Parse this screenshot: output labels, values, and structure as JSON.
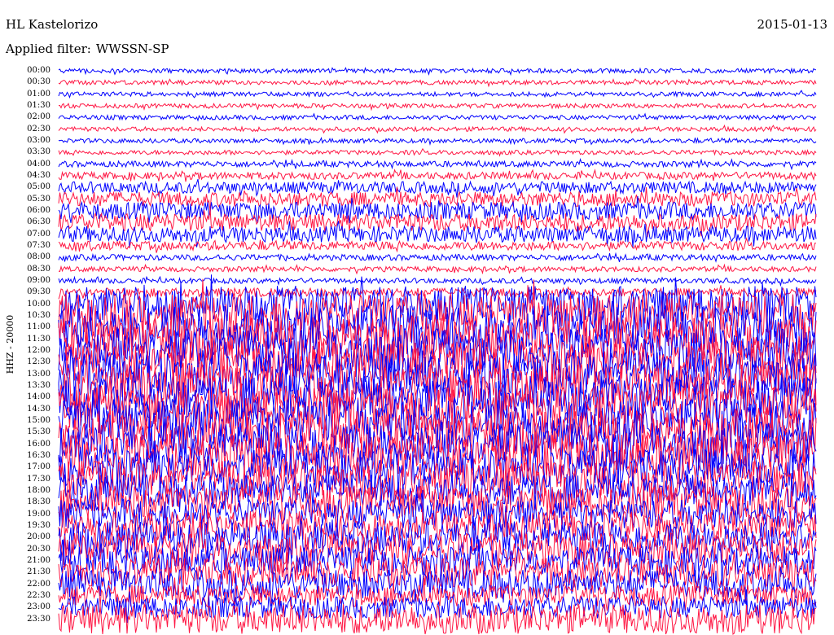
{
  "header": {
    "station": "HL Kastelorizo",
    "filter_label": "Applied filter:",
    "filter_value": "WWSSN-SP",
    "date": "2015-01-13"
  },
  "channel_label": "HHZ - 20000",
  "colors": {
    "trace_a": "#0000ff",
    "trace_b": "#ff1744",
    "background": "#ffffff",
    "text": "#000000"
  },
  "chart_data": {
    "type": "line",
    "title": "",
    "xlabel": "",
    "ylabel": "HHZ - 20000",
    "grid": false,
    "legend": "none",
    "row_duration_minutes": 30,
    "series": [
      {
        "color": "#0000ff",
        "rows": [
          "00:00",
          "01:00",
          "02:00",
          "03:00",
          "04:00",
          "05:00",
          "06:00",
          "07:00",
          "08:00",
          "09:00",
          "10:00",
          "11:00",
          "12:00",
          "13:00",
          "14:00",
          "15:00",
          "16:00",
          "17:00",
          "18:00",
          "19:00",
          "20:00",
          "21:00",
          "22:00",
          "23:00"
        ]
      },
      {
        "color": "#ff1744",
        "rows": [
          "00:30",
          "01:30",
          "02:30",
          "03:30",
          "04:30",
          "05:30",
          "06:30",
          "07:30",
          "08:30",
          "09:30",
          "10:30",
          "11:30",
          "12:30",
          "13:30",
          "14:30",
          "15:30",
          "16:30",
          "17:30",
          "18:30",
          "19:30",
          "20:30",
          "21:30",
          "22:30",
          "23:30"
        ]
      }
    ],
    "row_labels": [
      "00:00",
      "00:30",
      "01:00",
      "01:30",
      "02:00",
      "02:30",
      "03:00",
      "03:30",
      "04:00",
      "04:30",
      "05:00",
      "05:30",
      "06:00",
      "06:30",
      "07:00",
      "07:30",
      "08:00",
      "08:30",
      "09:00",
      "09:30",
      "10:00",
      "10:30",
      "11:00",
      "11:30",
      "12:00",
      "12:30",
      "13:00",
      "13:30",
      "14:00",
      "14:30",
      "15:00",
      "15:30",
      "16:00",
      "16:30",
      "17:00",
      "17:30",
      "18:00",
      "18:30",
      "19:00",
      "19:30",
      "20:00",
      "20:30",
      "21:00",
      "21:30",
      "22:00",
      "22:30",
      "23:00",
      "23:30"
    ],
    "row_amplitude_level": [
      0.3,
      0.3,
      0.3,
      0.3,
      0.3,
      0.3,
      0.3,
      0.3,
      0.4,
      0.5,
      0.8,
      1.0,
      1.2,
      1.2,
      1.1,
      0.6,
      0.4,
      0.35,
      0.35,
      0.6,
      2.5,
      3.0,
      3.0,
      3.0,
      3.0,
      3.0,
      3.0,
      3.0,
      3.0,
      3.0,
      3.0,
      3.0,
      3.0,
      3.0,
      2.5,
      2.5,
      2.3,
      2.3,
      2.0,
      2.0,
      2.2,
      2.2,
      2.0,
      2.0,
      2.0,
      1.5,
      1.5,
      2.0
    ]
  }
}
